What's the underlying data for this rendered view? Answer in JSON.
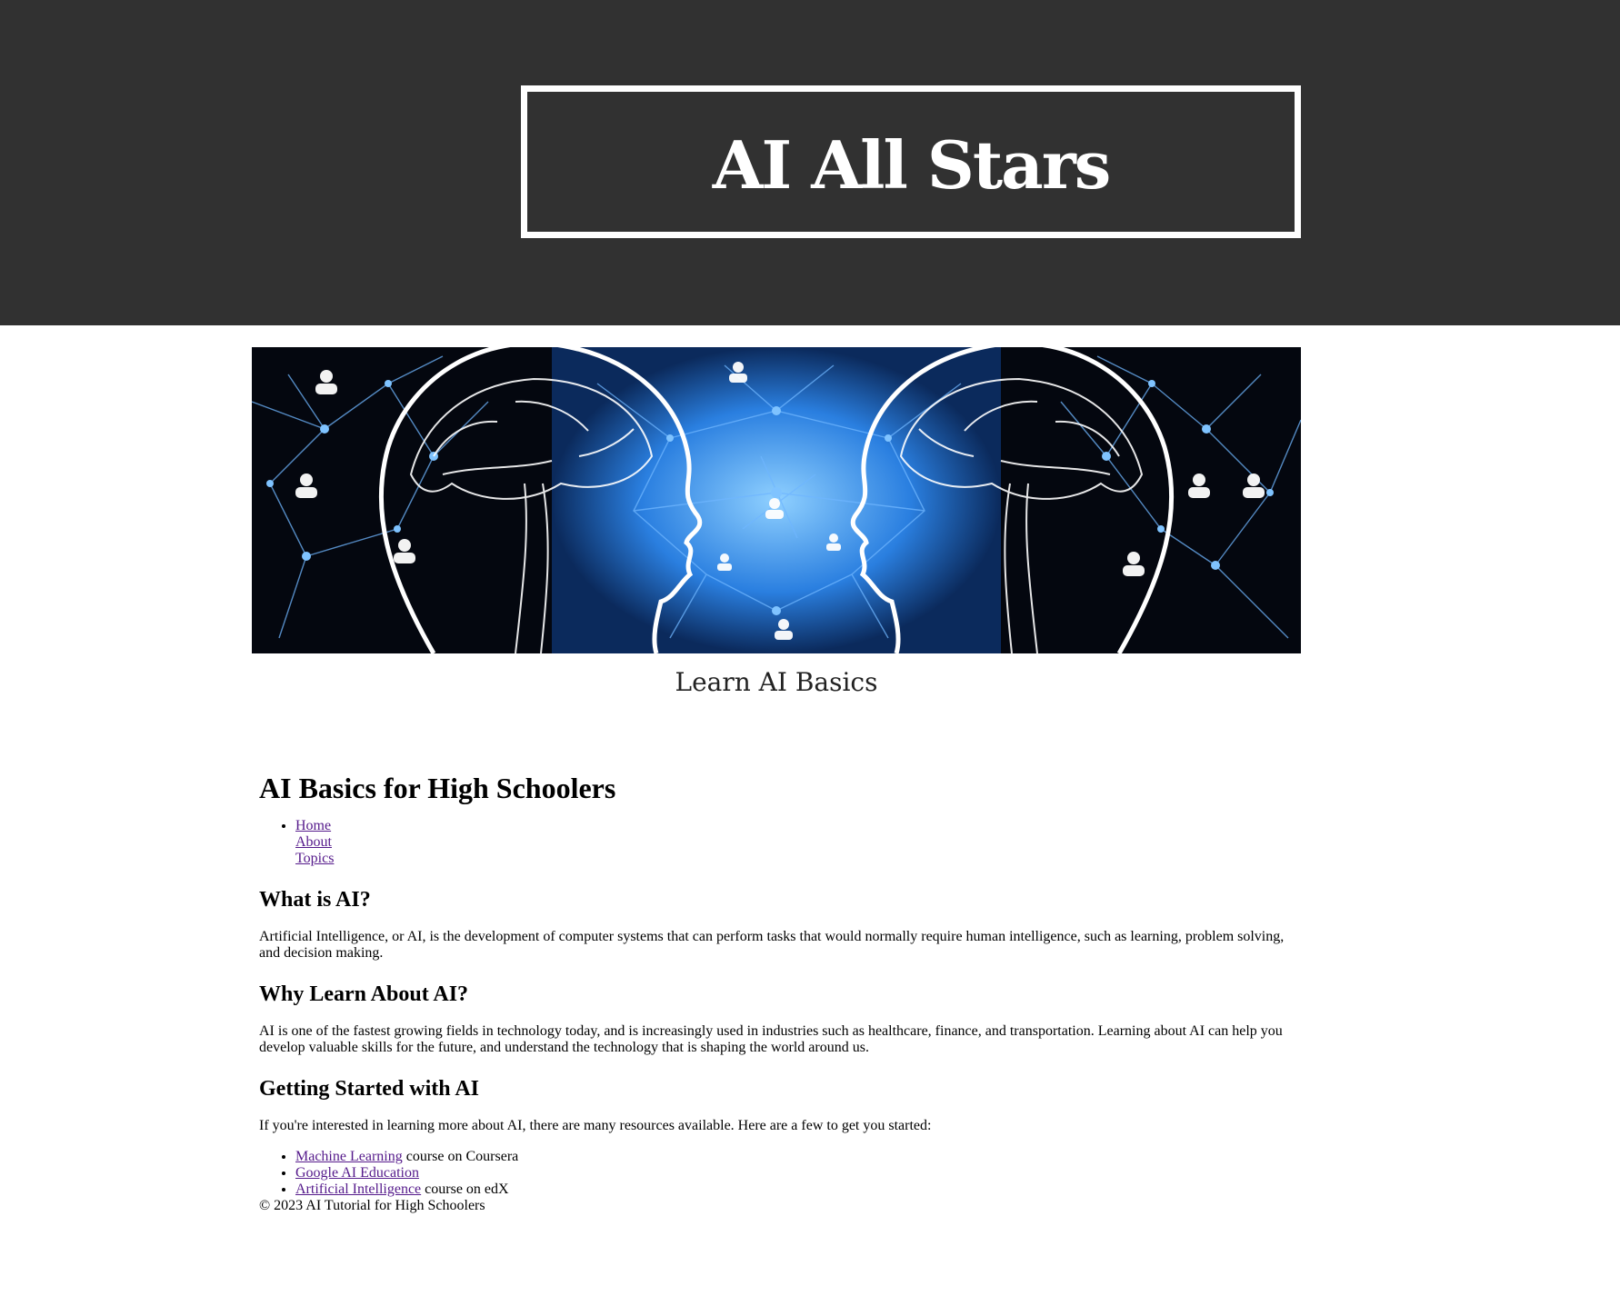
{
  "header": {
    "site_title": "AI All Stars"
  },
  "banner": {
    "image_name": "ai-brain-network-banner",
    "colors": {
      "background": "#04070f",
      "glow": "#2e8fe8",
      "line": "#ffffff"
    }
  },
  "tagline": "Learn AI Basics",
  "main": {
    "title": "AI Basics for High Schoolers",
    "nav": [
      "Home",
      "About",
      "Topics"
    ],
    "sections": [
      {
        "heading": "What is AI?",
        "body": "Artificial Intelligence, or AI, is the development of computer systems that can perform tasks that would normally require human intelligence, such as learning, problem solving, and decision making."
      },
      {
        "heading": "Why Learn About AI?",
        "body": "AI is one of the fastest growing fields in technology today, and is increasingly used in industries such as healthcare, finance, and transportation. Learning about AI can help you develop valuable skills for the future, and understand the technology that is shaping the world around us."
      },
      {
        "heading": "Getting Started with AI",
        "body": "If you're interested in learning more about AI, there are many resources available. Here are a few to get you started:"
      }
    ],
    "resources": [
      {
        "link": "Machine Learning",
        "suffix": " course on Coursera"
      },
      {
        "link": "Google AI Education",
        "suffix": ""
      },
      {
        "link": "Artificial Intelligence",
        "suffix": " course on edX"
      }
    ],
    "footer": "© 2023 AI Tutorial for High Schoolers"
  },
  "colors": {
    "header_bg": "#313131",
    "link": "#551a8b"
  }
}
